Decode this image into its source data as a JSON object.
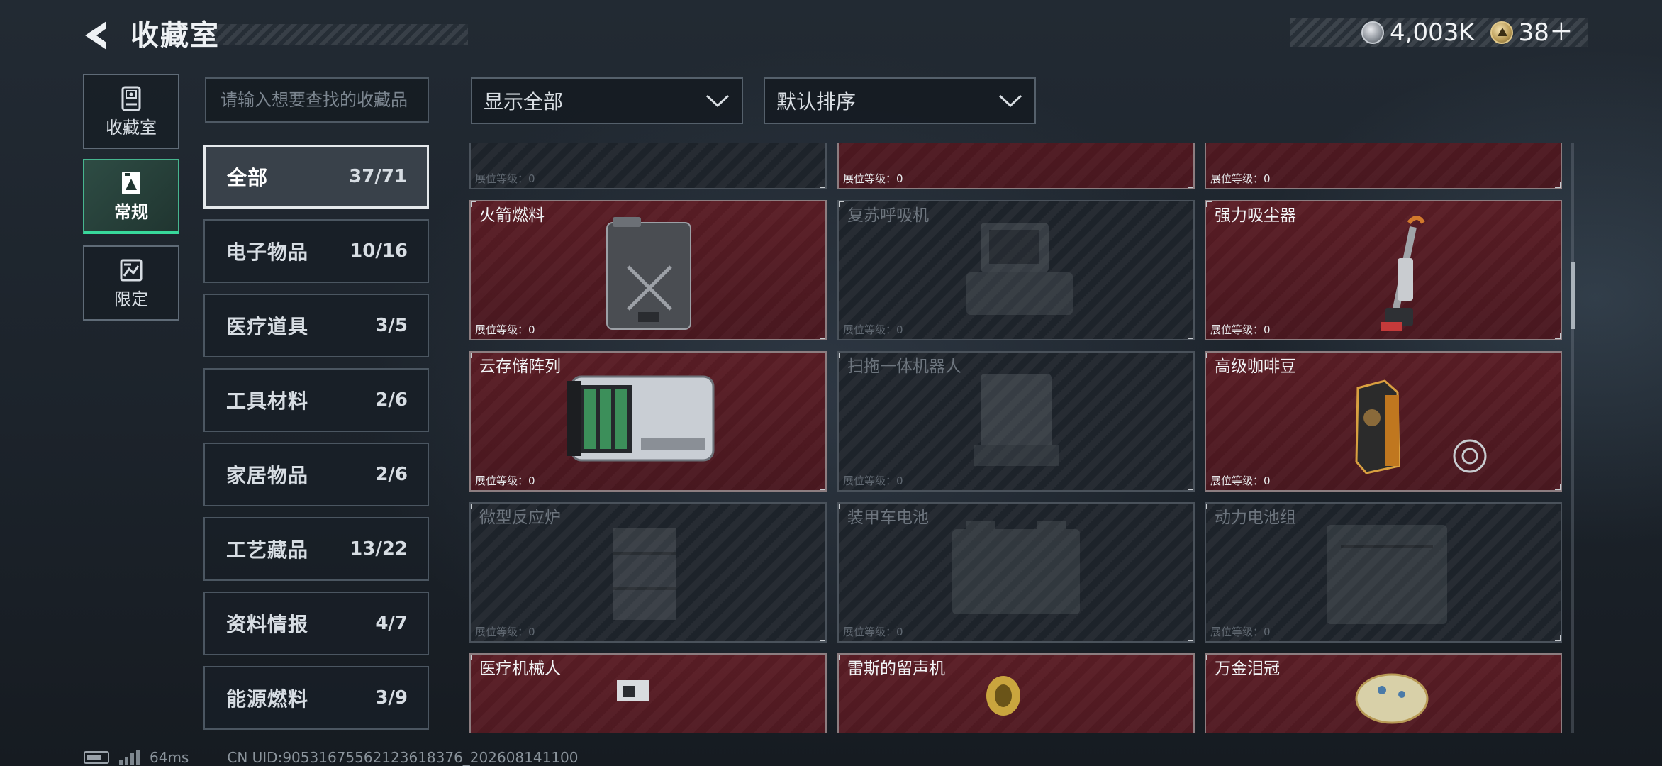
{
  "header": {
    "title": "收藏室",
    "currencies": [
      {
        "icon": "silver-coin-icon",
        "value": "4,003K"
      },
      {
        "icon": "ticket-icon",
        "value": "38＋"
      }
    ]
  },
  "rail": [
    {
      "label": "收藏室",
      "icon": "vault-icon",
      "active": false
    },
    {
      "label": "常规",
      "icon": "regular-collection-icon",
      "active": true
    },
    {
      "label": "限定",
      "icon": "limited-collection-icon",
      "active": false
    }
  ],
  "search": {
    "placeholder": "请输入想要查找的收藏品"
  },
  "filters": {
    "display": "显示全部",
    "sort": "默认排序"
  },
  "categories": [
    {
      "name": "全部",
      "count": "37/71",
      "active": true
    },
    {
      "name": "电子物品",
      "count": "10/16",
      "active": false
    },
    {
      "name": "医疗道具",
      "count": "3/5",
      "active": false
    },
    {
      "name": "工具材料",
      "count": "2/6",
      "active": false
    },
    {
      "name": "家居物品",
      "count": "2/6",
      "active": false
    },
    {
      "name": "工艺藏品",
      "count": "13/22",
      "active": false
    },
    {
      "name": "资料情报",
      "count": "4/7",
      "active": false
    },
    {
      "name": "能源燃料",
      "count": "3/9",
      "active": false
    }
  ],
  "level_label": "展位等级：",
  "items": [
    {
      "name": "",
      "owned": false,
      "level": "0",
      "art": "grenade"
    },
    {
      "name": "",
      "owned": true,
      "level": "0",
      "art": "rifle"
    },
    {
      "name": "",
      "owned": true,
      "level": "0",
      "art": "toolcase"
    },
    {
      "name": "火箭燃料",
      "owned": true,
      "level": "0",
      "art": "jerrycan"
    },
    {
      "name": "复苏呼吸机",
      "owned": false,
      "level": "0",
      "art": "ventilator"
    },
    {
      "name": "强力吸尘器",
      "owned": true,
      "level": "0",
      "art": "vacuum"
    },
    {
      "name": "云存储阵列",
      "owned": true,
      "level": "0",
      "art": "storage"
    },
    {
      "name": "扫拖一体机器人",
      "owned": false,
      "level": "0",
      "art": "robotvac"
    },
    {
      "name": "高级咖啡豆",
      "owned": true,
      "level": "0",
      "art": "coffee"
    },
    {
      "name": "微型反应炉",
      "owned": false,
      "level": "0",
      "art": "reactor"
    },
    {
      "name": "装甲车电池",
      "owned": false,
      "level": "0",
      "art": "battery"
    },
    {
      "name": "动力电池组",
      "owned": false,
      "level": "0",
      "art": "powerpack"
    },
    {
      "name": "医疗机械人",
      "owned": true,
      "level": "",
      "art": "medrobot"
    },
    {
      "name": "雷斯的留声机",
      "owned": true,
      "level": "",
      "art": "gramophone"
    },
    {
      "name": "万金泪冠",
      "owned": true,
      "level": "",
      "art": "crown"
    }
  ],
  "footer": {
    "ping": "64ms",
    "uid": "CN UID:90531675562123618376_202608141100"
  },
  "colors": {
    "accent": "#38d89b",
    "owned_card": "#5a1d25",
    "locked_card": "#1d232a"
  }
}
